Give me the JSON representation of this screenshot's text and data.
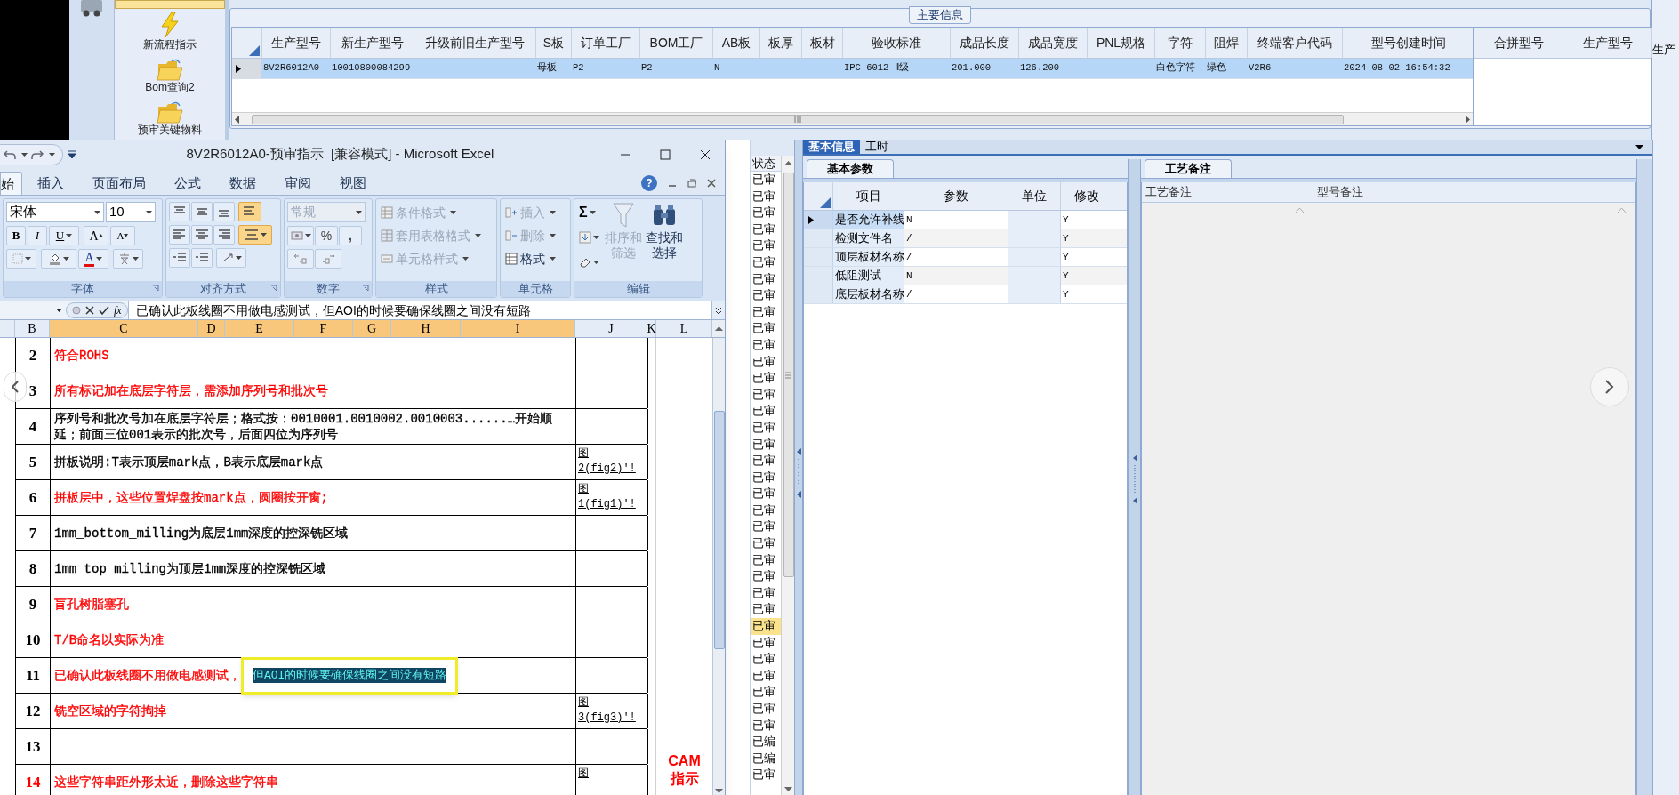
{
  "sidebar": {
    "items": [
      {
        "kind": "cut",
        "selected": true
      },
      {
        "kind": "lightning",
        "label": "新流程指示",
        "selected": false
      },
      {
        "kind": "folder",
        "label": "Bom查询2",
        "selected": false
      },
      {
        "kind": "folder",
        "label": "预审关键物料",
        "selected": false
      }
    ]
  },
  "main_info": {
    "title": "主要信息",
    "columns": [
      "生产型号",
      "新生产型号",
      "升级前旧生产型号",
      "S板",
      "订单工厂",
      "BOM工厂",
      "AB板",
      "板厚",
      "板材",
      "验收标准",
      "成品长度",
      "成品宽度",
      "PNL规格",
      "字符",
      "阻焊",
      "终端客户代码",
      "型号创建时间"
    ],
    "rows": [
      {
        "selected": true,
        "cells": [
          "8V2R6012A0",
          "10010800084299",
          null,
          "母板",
          "P2",
          "P2",
          "N",
          null,
          null,
          "IPC-6012 Ⅱ级",
          "201.000",
          "126.200",
          null,
          "白色字符",
          "绿色",
          "V2R6",
          "2024-08-02 16:54:32"
        ]
      }
    ],
    "side_columns": [
      "合拼型号",
      "生产型号"
    ]
  },
  "edge_label": "生产",
  "status_list": {
    "header": "状态",
    "items": [
      {
        "text": "已审",
        "selected": false
      },
      {
        "text": "已审",
        "selected": false
      },
      {
        "text": "已审",
        "selected": false
      },
      {
        "text": "已审",
        "selected": false
      },
      {
        "text": "已审",
        "selected": false
      },
      {
        "text": "已审",
        "selected": false
      },
      {
        "text": "已审",
        "selected": false
      },
      {
        "text": "已审",
        "selected": false
      },
      {
        "text": "已审",
        "selected": false
      },
      {
        "text": "已审",
        "selected": false
      },
      {
        "text": "已审",
        "selected": false
      },
      {
        "text": "已审",
        "selected": false
      },
      {
        "text": "已审",
        "selected": false
      },
      {
        "text": "已审",
        "selected": false
      },
      {
        "text": "已审",
        "selected": false
      },
      {
        "text": "已审",
        "selected": false
      },
      {
        "text": "已审",
        "selected": false
      },
      {
        "text": "已审",
        "selected": false
      },
      {
        "text": "已审",
        "selected": false
      },
      {
        "text": "已审",
        "selected": false
      },
      {
        "text": "已审",
        "selected": false
      },
      {
        "text": "已审",
        "selected": false
      },
      {
        "text": "已审",
        "selected": false
      },
      {
        "text": "已审",
        "selected": false
      },
      {
        "text": "已审",
        "selected": false
      },
      {
        "text": "已审",
        "selected": false
      },
      {
        "text": "已审",
        "selected": false
      },
      {
        "text": "已审",
        "selected": true
      },
      {
        "text": "已审",
        "selected": false
      },
      {
        "text": "已审",
        "selected": false
      },
      {
        "text": "已审",
        "selected": false
      },
      {
        "text": "已审",
        "selected": false
      },
      {
        "text": "已审",
        "selected": false
      },
      {
        "text": "已审",
        "selected": false
      },
      {
        "text": "已编",
        "selected": false
      },
      {
        "text": "已编",
        "selected": false
      },
      {
        "text": "已审",
        "selected": false
      }
    ]
  },
  "detail": {
    "tabs": [
      {
        "label": "基本信息",
        "selected": true
      },
      {
        "label": "工时",
        "selected": false
      }
    ],
    "basic_params": {
      "tab": "基本参数",
      "columns": [
        "项目",
        "参数",
        "单位",
        "修改"
      ],
      "rows": [
        {
          "item": "是否允许补线",
          "param": "N",
          "modify": "Y",
          "selected": true
        },
        {
          "item": "检测文件名",
          "param": "/",
          "modify": "Y",
          "selected": false
        },
        {
          "item": "顶层板材名称",
          "param": "/",
          "modify": "Y",
          "selected": false
        },
        {
          "item": "低阻测试",
          "param": "N",
          "modify": "Y",
          "selected": false
        },
        {
          "item": "底层板材名称",
          "param": "/",
          "modify": "Y",
          "selected": false
        }
      ]
    },
    "notes": {
      "tab": "工艺备注",
      "columns": [
        "工艺备注",
        "型号备注"
      ]
    }
  },
  "excel": {
    "title": "8V2R6012A0-预审指示  [兼容模式] - Microsoft Excel",
    "tabs": [
      {
        "label": "始",
        "selected": true
      },
      {
        "label": "插入",
        "selected": false
      },
      {
        "label": "页面布局",
        "selected": false
      },
      {
        "label": "公式",
        "selected": false
      },
      {
        "label": "数据",
        "selected": false
      },
      {
        "label": "审阅",
        "selected": false
      },
      {
        "label": "视图",
        "selected": false
      }
    ],
    "help": "?",
    "font": {
      "label": "字体",
      "name": "宋体",
      "size": "10",
      "bold": "B",
      "italic": "I",
      "underline": "U",
      "grow": "A",
      "shrink": "A",
      "color_label": "A"
    },
    "alignment": {
      "label": "对齐方式",
      "wrap_on": true,
      "merge_on": true
    },
    "number": {
      "label": "数字",
      "format": "常规",
      "format_disabled": true,
      "percent": "%",
      "comma": ","
    },
    "styles": {
      "label": "样式",
      "buttons": [
        {
          "label": "条件格式",
          "disabled": true
        },
        {
          "label": "套用表格格式",
          "disabled": true
        },
        {
          "label": "单元格样式",
          "disabled": true
        }
      ]
    },
    "cells": {
      "label": "单元格",
      "buttons": [
        {
          "label": "插入",
          "disabled": true
        },
        {
          "label": "删除",
          "disabled": true
        },
        {
          "label": "格式",
          "disabled": false
        }
      ]
    },
    "editing": {
      "label": "编辑",
      "sum": "Σ",
      "sort": {
        "label": "排序和筛选",
        "disabled": true
      },
      "find": {
        "label": "查找和选择",
        "disabled": false
      }
    },
    "function_label": "fx",
    "formula": "已确认此板线圈不用做电感测试，但AOI的时候要确保线圈之间没有短路",
    "columns": [
      {
        "label": "B",
        "selected": false
      },
      {
        "label": "C",
        "selected": true
      },
      {
        "label": "D",
        "selected": true
      },
      {
        "label": "E",
        "selected": true
      },
      {
        "label": "F",
        "selected": true
      },
      {
        "label": "G",
        "selected": true
      },
      {
        "label": "H",
        "selected": true
      },
      {
        "label": "I",
        "selected": true
      },
      {
        "label": "J",
        "selected": false
      },
      {
        "label": "K",
        "selected": false
      },
      {
        "label": "L",
        "selected": false
      }
    ],
    "rows": [
      {
        "number": "2",
        "text": "符合ROHS",
        "color": "#ff0000",
        "number_emphasis": false
      },
      {
        "number": "3",
        "text": "所有标记加在底层字符层，需添加序列号和批次号",
        "color": "#ff0000",
        "number_emphasis": false
      },
      {
        "number": "4",
        "text": "序列号和批次号加在底层字符层；格式按：0010001.0010002.0010003......…开始顺延；前面三位001表示的批次号，后面四位为序列号",
        "color": "#000000",
        "number_emphasis": false
      },
      {
        "number": "5",
        "text": "拼板说明:T表示顶层mark点，B表示底层mark点",
        "color": "#000000",
        "link": "图2(fig2)'!",
        "number_emphasis": false
      },
      {
        "number": "6",
        "text": "拼板层中，这些位置焊盘按mark点，圆圈按开窗;",
        "color": "#ff0000",
        "link": "图1(fig1)'!",
        "number_emphasis": false
      },
      {
        "number": "7",
        "text": "1mm_bottom_milling为底层1mm深度的控深铣区域",
        "color": "#000000",
        "number_emphasis": false
      },
      {
        "number": "8",
        "text": "1mm_top_milling为顶层1mm深度的控深铣区域",
        "color": "#000000",
        "number_emphasis": false
      },
      {
        "number": "9",
        "text": "盲孔树脂塞孔",
        "color": "#ff0000",
        "number_emphasis": false
      },
      {
        "number": "10",
        "text": "T/B命名以实际为准",
        "color": "#ff0000",
        "number_emphasis": false
      },
      {
        "number": "11",
        "text": "已确认此板线圈不用做电感测试，",
        "selected_text": "但AOI的时候要确保线圈之间没有短路",
        "annotated": true,
        "color": "#ff0000",
        "number_emphasis": false
      },
      {
        "number": "12",
        "text": "铣空区域的字符掏掉",
        "color": "#ff0000",
        "link": "图3(fig3)'!",
        "number_emphasis": false
      },
      {
        "number": "13",
        "number_emphasis": false
      },
      {
        "number": "14",
        "text": "这些字符串距外形太近，删除这些字符串",
        "color": "#ff0000",
        "link": "图",
        "number_emphasis": true
      }
    ],
    "side_label": "CAM指示"
  }
}
